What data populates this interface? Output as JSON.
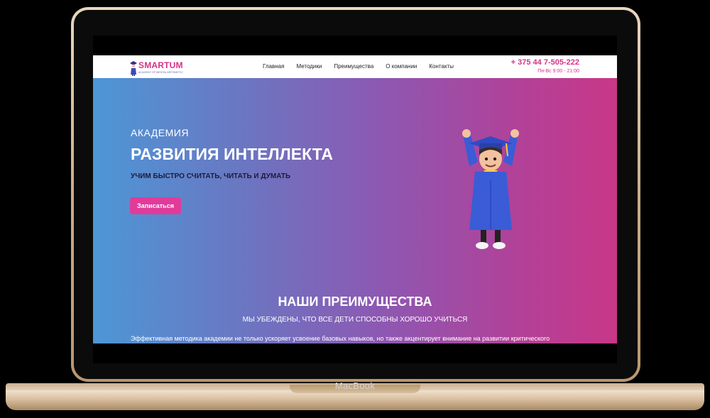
{
  "device": {
    "label": "MacBook"
  },
  "header": {
    "logo_title": "SMARTUM",
    "logo_subtitle": "ACADEMY OF MENTAL ARITHMETIC",
    "nav": [
      "Главная",
      "Методики",
      "Преимущества",
      "О компании",
      "Контакты"
    ],
    "phone": "+ 375 44 7-505-222",
    "hours": "Пн-Вс 9:00 - 21:00"
  },
  "hero": {
    "kicker": "АКАДЕМИЯ",
    "title": "РАЗВИТИЯ ИНТЕЛЛЕКТА",
    "subtitle": "УЧИМ БЫСТРО СЧИТАТЬ, ЧИТАТЬ И ДУМАТЬ",
    "cta_label": "Записаться"
  },
  "advantages": {
    "title": "НАШИ ПРЕИМУЩЕСТВА",
    "subtitle": "МЫ УБЕЖДЕНЫ, ЧТО ВСЕ ДЕТИ СПОСОБНЫ ХОРОШО УЧИТЬСЯ",
    "text": "Эффективная методика академии не только ускоряет усвоение базовых навыков, но также акцентирует внимание на развитии критического"
  },
  "colors": {
    "accent": "#d7328a",
    "button": "#e13b9a",
    "gradient_left": "#4d97d6",
    "gradient_right": "#c93787"
  },
  "icons": {
    "logo": "graduate-logo-icon",
    "mascot": "graduate-boy-illustration"
  }
}
